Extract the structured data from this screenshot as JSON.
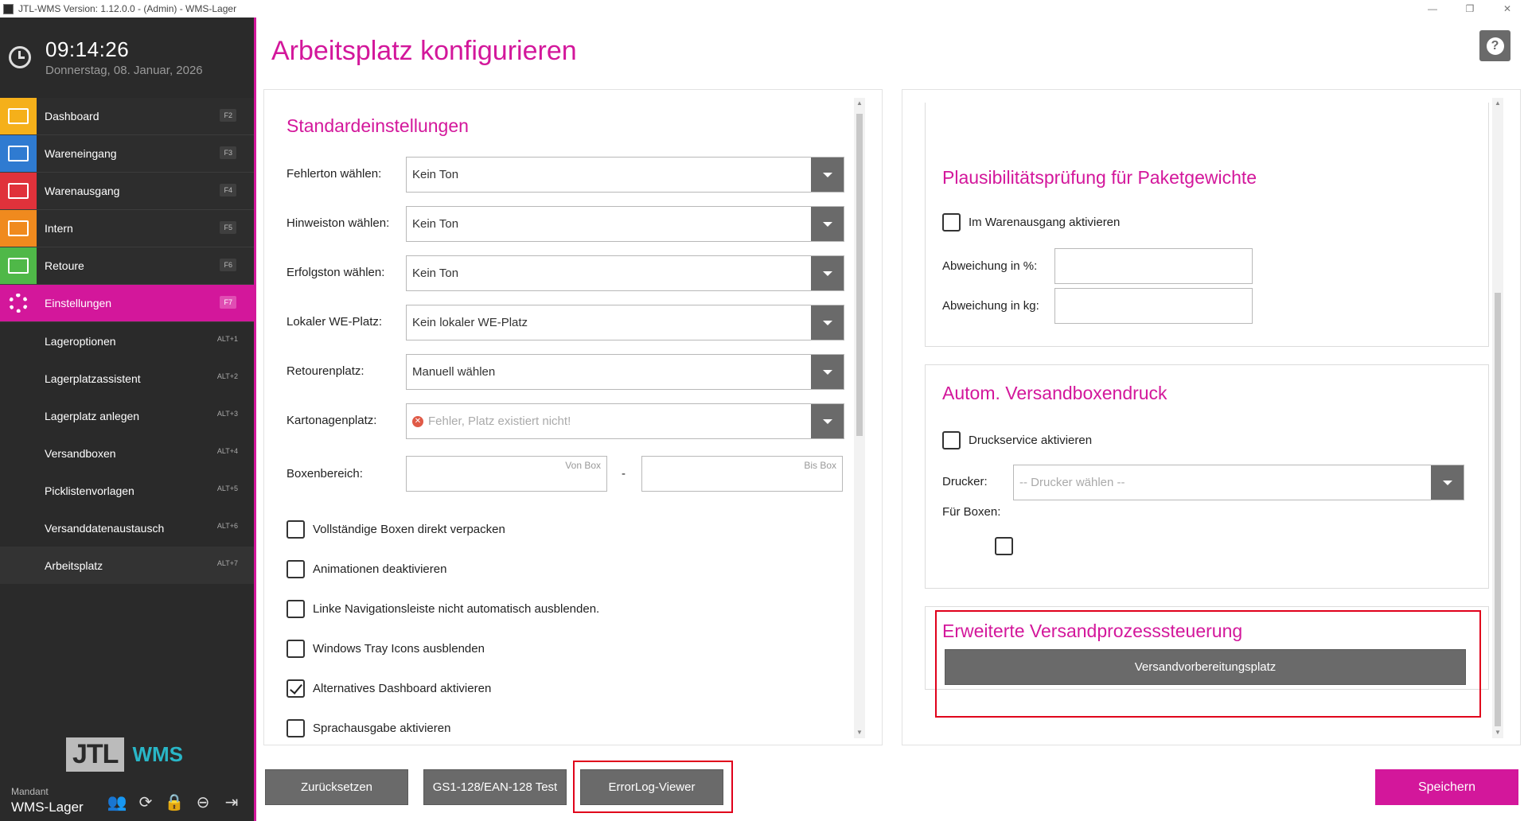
{
  "window": {
    "title": "JTL-WMS Version: 1.12.0.0 - (Admin) - WMS-Lager",
    "minimize_icon": "—",
    "restore_icon": "❐",
    "close_icon": "✕"
  },
  "clock": {
    "time": "09:14:26",
    "date": "Donnerstag, 08. Januar, 2026"
  },
  "nav": {
    "items": [
      {
        "label": "Dashboard",
        "key": "F2",
        "color": "#f5b01a"
      },
      {
        "label": "Wareneingang",
        "key": "F3",
        "color": "#2f7bd1"
      },
      {
        "label": "Warenausgang",
        "key": "F4",
        "color": "#e0323b"
      },
      {
        "label": "Intern",
        "key": "F5",
        "color": "#f08a1e"
      },
      {
        "label": "Retoure",
        "key": "F6",
        "color": "#4fb848"
      },
      {
        "label": "Einstellungen",
        "key": "F7",
        "color": "#d3179b"
      }
    ],
    "subitems": [
      {
        "label": "Lageroptionen",
        "key": "ALT+1"
      },
      {
        "label": "Lagerplatzassistent",
        "key": "ALT+2"
      },
      {
        "label": "Lagerplatz anlegen",
        "key": "ALT+3"
      },
      {
        "label": "Versandboxen",
        "key": "ALT+4"
      },
      {
        "label": "Picklistenvorlagen",
        "key": "ALT+5"
      },
      {
        "label": "Versanddatenaustausch",
        "key": "ALT+6"
      },
      {
        "label": "Arbeitsplatz",
        "key": "ALT+7"
      }
    ]
  },
  "logo": {
    "jtl": "JTL",
    "wms": "WMS"
  },
  "mandant": {
    "label": "Mandant",
    "value": "WMS-Lager"
  },
  "page": {
    "title": "Arbeitsplatz konfigurieren",
    "help": "?"
  },
  "standard": {
    "title": "Standardeinstellungen",
    "fehlerton_label": "Fehlerton wählen:",
    "fehlerton_value": "Kein Ton",
    "hinweiston_label": "Hinweiston wählen:",
    "hinweiston_value": "Kein Ton",
    "erfolgston_label": "Erfolgston wählen:",
    "erfolgston_value": "Kein Ton",
    "we_platz_label": "Lokaler WE-Platz:",
    "we_platz_value": "Kein lokaler WE-Platz",
    "retouren_label": "Retourenplatz:",
    "retouren_value": "Manuell wählen",
    "karton_label": "Kartonagenplatz:",
    "karton_value": "Fehler, Platz existiert nicht!",
    "boxen_label": "Boxenbereich:",
    "von_box": "Von Box",
    "bis_box": "Bis Box",
    "dash": "-",
    "checks": [
      {
        "label": "Vollständige Boxen direkt verpacken",
        "checked": false
      },
      {
        "label": "Animationen deaktivieren",
        "checked": false
      },
      {
        "label": "Linke Navigationsleiste nicht automatisch ausblenden.",
        "checked": false
      },
      {
        "label": "Windows Tray Icons ausblenden",
        "checked": false
      },
      {
        "label": "Alternatives Dashboard aktivieren",
        "checked": true
      },
      {
        "label": "Sprachausgabe aktivieren",
        "checked": false
      }
    ]
  },
  "plaus": {
    "title": "Plausibilitätsprüfung für Paketgewichte",
    "check_label": "Im Warenausgang aktivieren",
    "abw_pct_label": "Abweichung in %:",
    "abw_kg_label": "Abweichung in kg:"
  },
  "versandbox": {
    "title": "Autom. Versandboxendruck",
    "check_label": "Druckservice aktivieren",
    "drucker_label": "Drucker:",
    "drucker_placeholder": "-- Drucker wählen --",
    "boxen_label": "Für Boxen:"
  },
  "erweitert": {
    "title": "Erweiterte Versandprozesssteuerung",
    "button": "Versandvorbereitungsplatz"
  },
  "footer": {
    "reset": "Zurücksetzen",
    "gs1": "GS1-128/EAN-128 Test",
    "errorlog": "ErrorLog-Viewer",
    "save": "Speichern"
  }
}
